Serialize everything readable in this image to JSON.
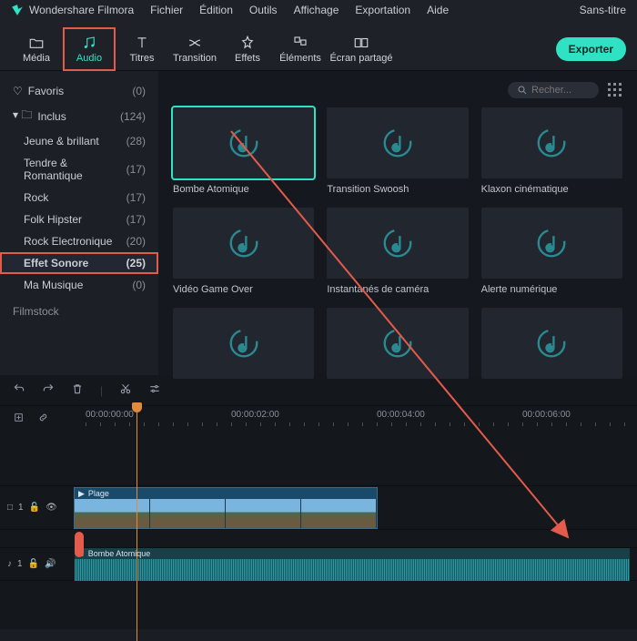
{
  "app": {
    "name": "Wondershare Filmora",
    "doc": "Sans-titre"
  },
  "menu": [
    "Fichier",
    "Édition",
    "Outils",
    "Affichage",
    "Exportation",
    "Aide"
  ],
  "tabs": [
    {
      "id": "media",
      "label": "Média"
    },
    {
      "id": "audio",
      "label": "Audio"
    },
    {
      "id": "titles",
      "label": "Titres"
    },
    {
      "id": "transition",
      "label": "Transition"
    },
    {
      "id": "effects",
      "label": "Effets"
    },
    {
      "id": "elements",
      "label": "Éléments"
    },
    {
      "id": "split",
      "label": "Écran partagé"
    }
  ],
  "export_label": "Exporter",
  "sidebar": {
    "favorites": {
      "label": "Favoris",
      "count": "(0)"
    },
    "included": {
      "label": "Inclus",
      "count": "(124)"
    },
    "items": [
      {
        "label": "Jeune & brillant",
        "count": "(28)"
      },
      {
        "label": "Tendre & Romantique",
        "count": "(17)"
      },
      {
        "label": "Rock",
        "count": "(17)"
      },
      {
        "label": "Folk Hipster",
        "count": "(17)"
      },
      {
        "label": "Rock Electronique",
        "count": "(20)"
      },
      {
        "label": "Effet Sonore",
        "count": "(25)"
      },
      {
        "label": "Ma Musique",
        "count": "(0)"
      }
    ],
    "filmstock": "Filmstock"
  },
  "search_placeholder": "Recher...",
  "clips": [
    "Bombe Atomique",
    "Transition Swoosh",
    "Klaxon cinématique",
    "Vidéo Game Over",
    "Instantanés de caméra",
    "Alerte numérique",
    "",
    "",
    ""
  ],
  "ruler": [
    "00:00:00:00",
    "00:00:02:00",
    "00:00:04:00",
    "00:00:06:00"
  ],
  "tracks": {
    "video": {
      "id": "1",
      "clip": "Plage"
    },
    "audio": {
      "id": "1",
      "clip": "Bombe Atomique"
    }
  },
  "icon_box": "□"
}
